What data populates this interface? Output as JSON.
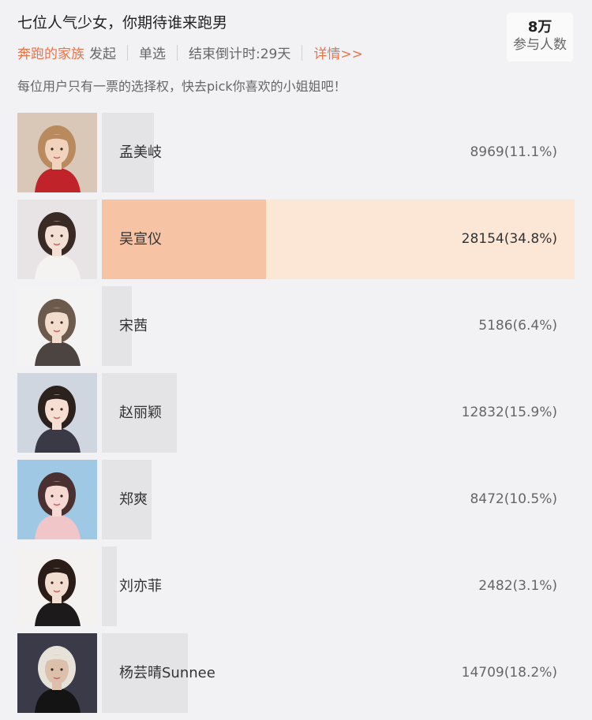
{
  "poll": {
    "title": "七位人气少女，你期待谁来跑男",
    "author": "奔跑的家族",
    "author_suffix": "发起",
    "type": "单选",
    "countdown": "结束倒计时:29天",
    "details_link": "详情>>",
    "description": "每位用户只有一票的选择权，快去pick你喜欢的小姐姐吧！",
    "participants_count": "8万",
    "participants_label": "参与人数"
  },
  "options": [
    {
      "name": "孟美岐",
      "result": "8969(11.1%)",
      "percent": 11.1,
      "selected": false,
      "photo": "portrait-red-background"
    },
    {
      "name": "吴宣仪",
      "result": "28154(34.8%)",
      "percent": 34.8,
      "selected": true,
      "photo": "portrait-light-background"
    },
    {
      "name": "宋茜",
      "result": "5186(6.4%)",
      "percent": 6.4,
      "selected": false,
      "photo": "portrait-plaid-jacket"
    },
    {
      "name": "赵丽颖",
      "result": "12832(15.9%)",
      "percent": 15.9,
      "selected": false,
      "photo": "portrait-hat-smiling"
    },
    {
      "name": "郑爽",
      "result": "8472(10.5%)",
      "percent": 10.5,
      "selected": false,
      "photo": "portrait-blue-background"
    },
    {
      "name": "刘亦菲",
      "result": "2482(3.1%)",
      "percent": 3.1,
      "selected": false,
      "photo": "portrait-white-background"
    },
    {
      "name": "杨芸晴Sunnee",
      "result": "14709(18.2%)",
      "percent": 18.2,
      "selected": false,
      "photo": "portrait-dark-sky"
    }
  ],
  "colors": {
    "accent": "#e9744a",
    "selected_fill": "#f6c3a5",
    "selected_track": "#fce6d6",
    "bar_fill": "#e4e4e7",
    "background": "#f2f2f5"
  }
}
